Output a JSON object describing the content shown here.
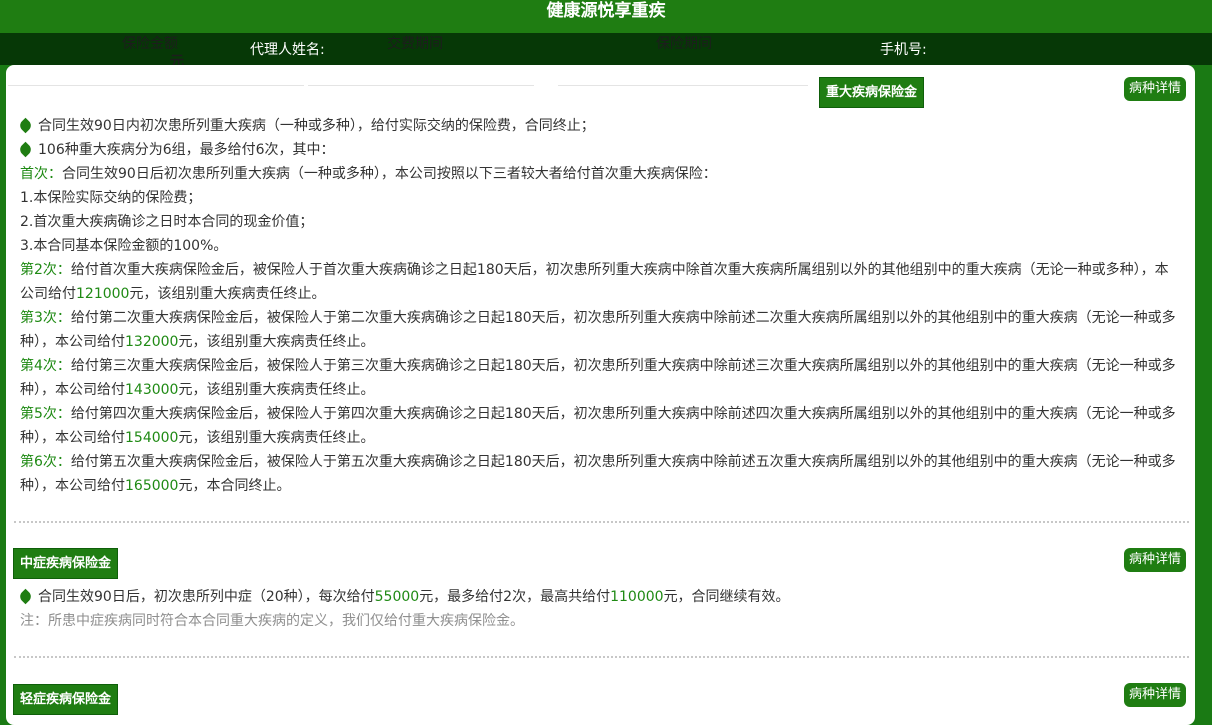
{
  "header": {
    "title": "健康源悦享重疾"
  },
  "infobar": {
    "agent_label": "代理人姓名:",
    "phone_label": "手机号:",
    "ghost_amount_label": "保险金额",
    "ghost_amount_value": "元",
    "ghost_payperiod_label": "交费期间",
    "ghost_cover_label": "保险期间"
  },
  "sections": {
    "major": {
      "tag": "重大疾病保险金",
      "detail_btn": "病种详情",
      "line1": "合同生效90日内初次患所列重大疾病（一种或多种），给付实际交纳的保险费，合同终止；",
      "line2": "106种重大疾病分为6组，最多给付6次，其中：",
      "first_label": "首次：",
      "first_text": "合同生效90日后初次患所列重大疾病（一种或多种），本公司按照以下三者较大者给付首次重大疾病保险：",
      "item1": "1.本保险实际交纳的保险费；",
      "item2": "2.首次重大疾病确诊之日时本合同的现金价值；",
      "item3": "3.本合同基本保险金额的100%。",
      "times": [
        {
          "label": "第2次：",
          "text": "给付首次重大疾病保险金后，被保险人于首次重大疾病确诊之日起180天后，初次患所列重大疾病中除首次重大疾病所属组别以外的其他组别中的重大疾病（无论一种或多种），本公司给付",
          "amount": "121000",
          "tail": "元，该组别重大疾病责任终止。"
        },
        {
          "label": "第3次：",
          "text": "给付第二次重大疾病保险金后，被保险人于第二次重大疾病确诊之日起180天后，初次患所列重大疾病中除前述二次重大疾病所属组别以外的其他组别中的重大疾病（无论一种或多种），本公司给付",
          "amount": "132000",
          "tail": "元，该组别重大疾病责任终止。"
        },
        {
          "label": "第4次：",
          "text": "给付第三次重大疾病保险金后，被保险人于第三次重大疾病确诊之日起180天后，初次患所列重大疾病中除前述三次重大疾病所属组别以外的其他组别中的重大疾病（无论一种或多种），本公司给付",
          "amount": "143000",
          "tail": "元，该组别重大疾病责任终止。"
        },
        {
          "label": "第5次：",
          "text": "给付第四次重大疾病保险金后，被保险人于第四次重大疾病确诊之日起180天后，初次患所列重大疾病中除前述四次重大疾病所属组别以外的其他组别中的重大疾病（无论一种或多种），本公司给付",
          "amount": "154000",
          "tail": "元，该组别重大疾病责任终止。"
        },
        {
          "label": "第6次：",
          "text": "给付第五次重大疾病保险金后，被保险人于第五次重大疾病确诊之日起180天后，初次患所列重大疾病中除前述五次重大疾病所属组别以外的其他组别中的重大疾病（无论一种或多种），本公司给付",
          "amount": "165000",
          "tail": "元，本合同终止。"
        }
      ]
    },
    "mid": {
      "tag": "中症疾病保险金",
      "detail_btn": "病种详情",
      "text_a": "合同生效90日后，初次患所列中症（20种），每次给付",
      "amount_a": "55000",
      "text_b": "元，最多给付2次，最高共给付",
      "amount_b": "110000",
      "text_c": "元，合同继续有效。",
      "note": "注：所患中症疾病同时符合本合同重大疾病的定义，我们仅给付重大疾病保险金。"
    },
    "light": {
      "tag": "轻症疾病保险金",
      "detail_btn": "病种详情"
    }
  },
  "colors": {
    "brand_green": "#1f7d12",
    "dark_bar": "#063806",
    "amount_green": "#1f8a14"
  },
  "icons": {
    "bullet": "leaf-icon"
  }
}
